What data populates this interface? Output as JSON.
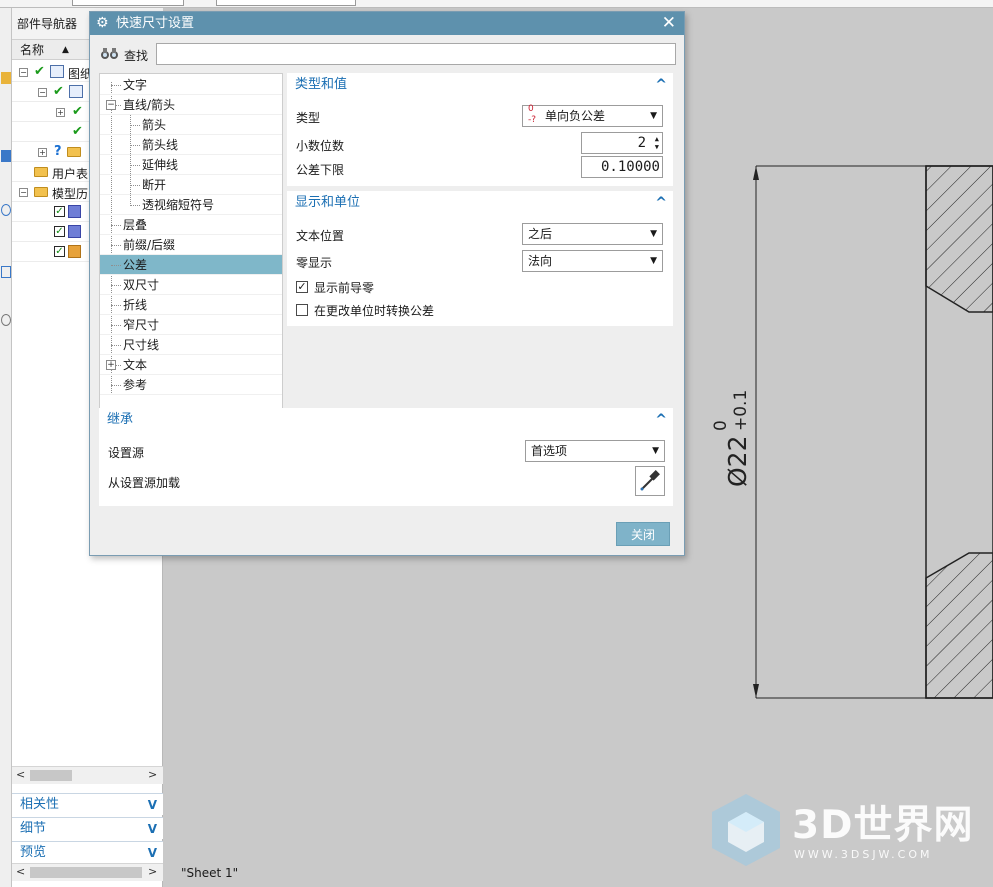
{
  "navigator": {
    "title": "部件导航器",
    "column_name": "名称",
    "rows": [
      {
        "label": "图纸"
      },
      {
        "label": ""
      },
      {
        "label": ""
      },
      {
        "label": ""
      },
      {
        "label": ""
      },
      {
        "label": "用户表"
      },
      {
        "label": "模型历"
      },
      {
        "label": ""
      },
      {
        "label": ""
      },
      {
        "label": ""
      }
    ],
    "panels": [
      "相关性",
      "细节",
      "预览"
    ]
  },
  "dialog": {
    "title": "快速尺寸设置",
    "find_label": "查找",
    "find_value": "",
    "tree": [
      {
        "label": "文字",
        "level": 0
      },
      {
        "label": "直线/箭头",
        "level": 0,
        "expander": "−"
      },
      {
        "label": "箭头",
        "level": 1
      },
      {
        "label": "箭头线",
        "level": 1
      },
      {
        "label": "延伸线",
        "level": 1
      },
      {
        "label": "断开",
        "level": 1
      },
      {
        "label": "透视缩短符号",
        "level": 1
      },
      {
        "label": "层叠",
        "level": 0
      },
      {
        "label": "前缀/后缀",
        "level": 0
      },
      {
        "label": "公差",
        "level": 0,
        "selected": true
      },
      {
        "label": "双尺寸",
        "level": 0
      },
      {
        "label": "折线",
        "level": 0
      },
      {
        "label": "窄尺寸",
        "level": 0
      },
      {
        "label": "尺寸线",
        "level": 0
      },
      {
        "label": "文本",
        "level": 0,
        "expander": "+"
      },
      {
        "label": "参考",
        "level": 0
      }
    ],
    "type_section": {
      "heading": "类型和值",
      "type_label": "类型",
      "type_value": "单向负公差",
      "decimals_label": "小数位数",
      "decimals_value": "2",
      "lower_label": "公差下限",
      "lower_value": "0.10000"
    },
    "display_section": {
      "heading": "显示和单位",
      "text_pos_label": "文本位置",
      "text_pos_value": "之后",
      "zero_label": "零显示",
      "zero_value": "法向",
      "leading_zero_label": "显示前导零",
      "leading_zero_checked": true,
      "convert_label": "在更改单位时转换公差",
      "convert_checked": false
    },
    "inherit_section": {
      "heading": "继承",
      "source_label": "设置源",
      "source_value": "首选项",
      "load_label": "从设置源加载"
    },
    "close_label": "关闭"
  },
  "drawing": {
    "sheet_label": "\"Sheet 1\"",
    "dim_upper": "0",
    "dim_main": "Ø22",
    "dim_lower": "+0.1"
  },
  "watermark": {
    "text": "3D世界网",
    "url": "WWW.3DSJW.COM"
  },
  "colors": {
    "title_bar": "#5e91ad",
    "selected": "#7fb7c9",
    "accent_text": "#1b6fb3"
  }
}
